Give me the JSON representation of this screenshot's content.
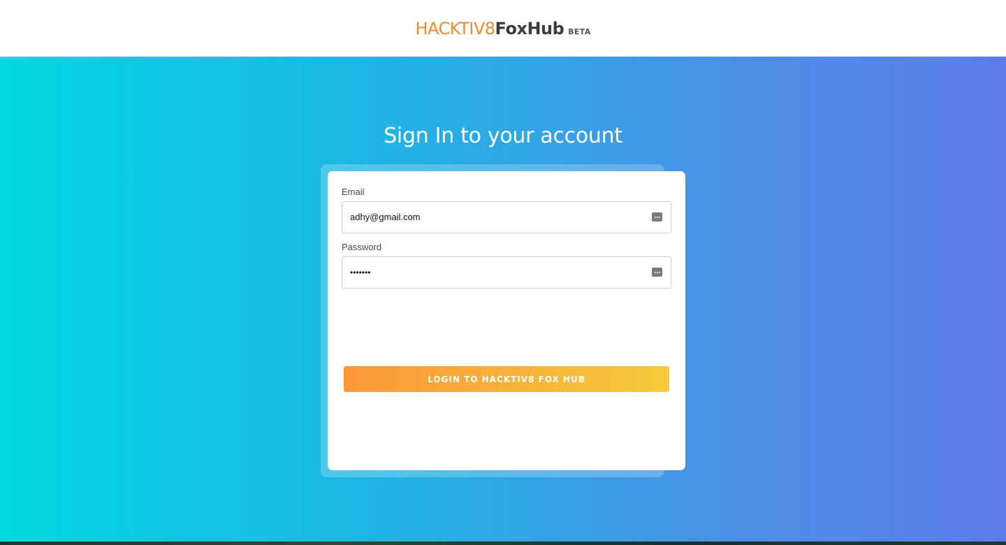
{
  "header": {
    "logo_part1": "HACKTIV8",
    "logo_part2": "FoxHub",
    "logo_badge": "BETA"
  },
  "main": {
    "heading": "Sign In to your account"
  },
  "form": {
    "email_label": "Email",
    "email_value": "adhy@gmail.com",
    "password_label": "Password",
    "password_value": "•••••••",
    "submit_label": "LOGIN TO HACKTIV8 FOX HUB"
  },
  "icons": {
    "field_autofill": "dots-icon"
  },
  "colors": {
    "brand_orange": "#f08a2c",
    "brand_dark": "#3d3d3d",
    "gradient_start": "#00d8e0",
    "gradient_end": "#5c7ce8",
    "button_start": "#fb9737",
    "button_end": "#f6ca3a"
  }
}
